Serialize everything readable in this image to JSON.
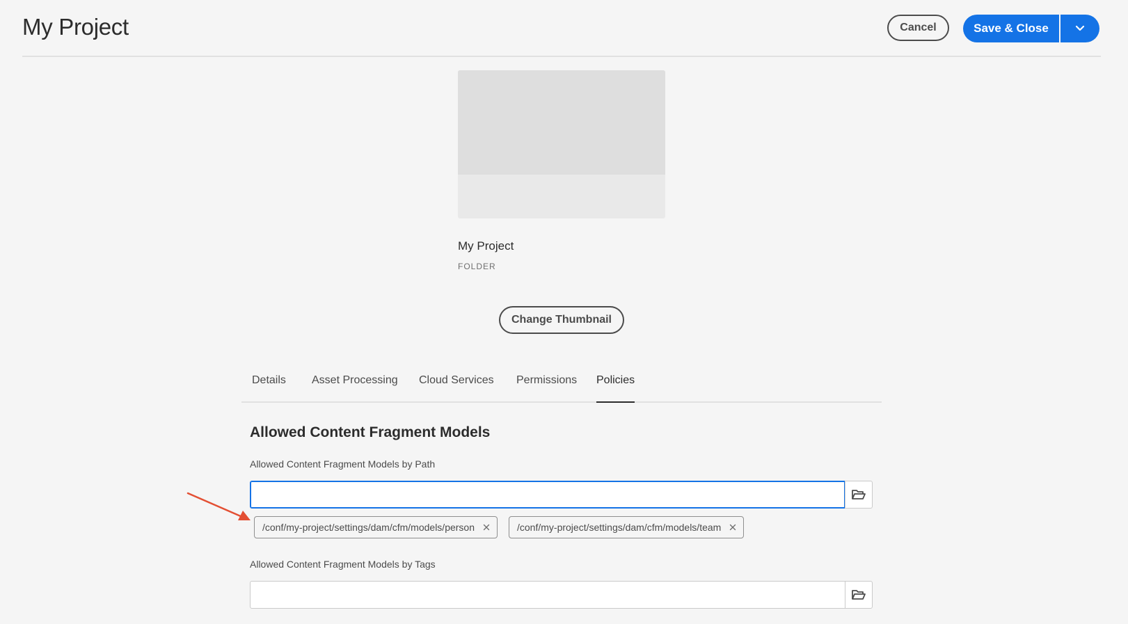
{
  "header": {
    "title": "My Project",
    "cancel_label": "Cancel",
    "save_label": "Save & Close"
  },
  "item": {
    "name": "My Project",
    "type": "FOLDER",
    "change_thumbnail_label": "Change Thumbnail"
  },
  "tabs": [
    {
      "label": "Details",
      "active": false
    },
    {
      "label": "Asset Processing",
      "active": false
    },
    {
      "label": "Cloud Services",
      "active": false
    },
    {
      "label": "Permissions",
      "active": false
    },
    {
      "label": "Policies",
      "active": true
    }
  ],
  "policies": {
    "heading": "Allowed Content Fragment Models",
    "by_path": {
      "label": "Allowed Content Fragment Models by Path",
      "value": "",
      "tags": [
        "/conf/my-project/settings/dam/cfm/models/person",
        "/conf/my-project/settings/dam/cfm/models/team"
      ]
    },
    "by_tags": {
      "label": "Allowed Content Fragment Models by Tags",
      "value": ""
    }
  },
  "colors": {
    "accent": "#1473e6",
    "annotation_arrow": "#e34f33",
    "background": "#f5f5f5"
  },
  "icons": {
    "dropdown": "chevron-down-icon",
    "browse": "folder-open-icon",
    "remove_tag": "close-icon"
  }
}
